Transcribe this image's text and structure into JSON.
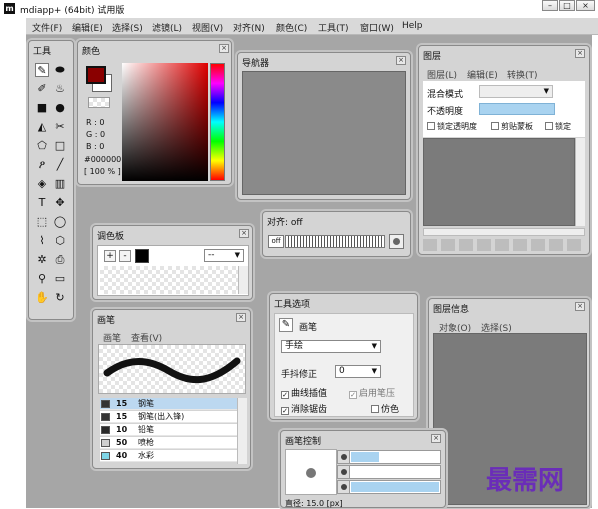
{
  "window": {
    "title": "mdiapp+ (64bit) 试用版",
    "min": "–",
    "max": "□",
    "close": "×"
  },
  "menu": [
    "文件(F)",
    "编辑(E)",
    "选择(S)",
    "滤镜(L)",
    "视图(V)",
    "对齐(N)",
    "颜色(C)",
    "工具(T)",
    "窗口(W)",
    "Help"
  ],
  "tools": {
    "title": "工具"
  },
  "color": {
    "title": "颜色",
    "fg": "#8a0000",
    "r": "R : 0",
    "g": "G : 0",
    "b": "B : 0",
    "hex": "#000000",
    "opacity": "[ 100 % ]"
  },
  "navigator": {
    "title": "导航器"
  },
  "layers": {
    "title": "图层",
    "menu": [
      "图层(L)",
      "编辑(E)",
      "转换(T)"
    ],
    "blend_label": "混合模式",
    "opacity_label": "不透明度",
    "lock_alpha": "锁定透明度",
    "clip": "剪贴蒙板",
    "lock": "锁定"
  },
  "align": {
    "title": "对齐: off",
    "off_label": "off"
  },
  "palette": {
    "title": "调色板",
    "add": "+",
    "remove": "-",
    "select_value": "--"
  },
  "tool_options": {
    "title": "工具选项",
    "tool_name": "画笔",
    "mode": "手绘",
    "stabilizer_label": "手抖修正",
    "stabilizer_value": "0",
    "curve": "曲线插值",
    "pressure": "启用笔压",
    "antialias": "消除锯齿",
    "imitate": "仿色"
  },
  "brush": {
    "title": "画笔",
    "menu": [
      "画笔",
      "查看(V)"
    ],
    "rows": [
      {
        "size": "15",
        "name": "钢笔",
        "color": "#333333",
        "selected": true
      },
      {
        "size": "15",
        "name": "钢笔(出入锋)",
        "color": "#333333",
        "selected": false
      },
      {
        "size": "10",
        "name": "铅笔",
        "color": "#2a2a2a",
        "selected": false
      },
      {
        "size": "50",
        "name": "喷枪",
        "color": "#cfcfcf",
        "selected": false
      },
      {
        "size": "40",
        "name": "水彩",
        "color": "#7fd6e8",
        "selected": false
      }
    ]
  },
  "layer_info": {
    "title": "图层信息",
    "menu": [
      "对象(O)",
      "选择(S)"
    ]
  },
  "brush_control": {
    "title": "画笔控制",
    "diameter": "直径: 15.0 [px]"
  },
  "watermark": "最需网"
}
